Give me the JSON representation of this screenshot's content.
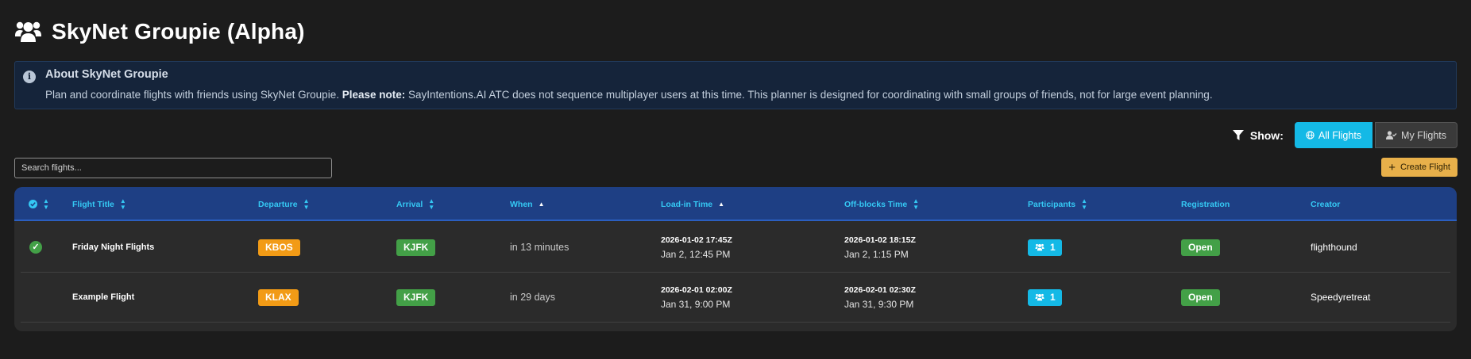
{
  "header": {
    "title": "SkyNet Groupie (Alpha)",
    "icon": "users-icon"
  },
  "about": {
    "heading": "About SkyNet Groupie",
    "text_before": "Plan and coordinate flights with friends using SkyNet Groupie.",
    "note_label": "Please note:",
    "text_after": "SayIntentions.AI ATC does not sequence multiplayer users at this time. This planner is designed for coordinating with small groups of friends, not for large event planning."
  },
  "filter": {
    "label": "Show:",
    "all_label": "All Flights",
    "my_label": "My Flights",
    "active": "All Flights"
  },
  "search": {
    "placeholder": "Search flights..."
  },
  "create_button": {
    "label": "Create Flight"
  },
  "table": {
    "headers": {
      "flight_title": "Flight Title",
      "departure": "Departure",
      "arrival": "Arrival",
      "when": "When",
      "load_in": "Load-in Time",
      "off_blocks": "Off-blocks Time",
      "participants": "Participants",
      "registration": "Registration",
      "creator": "Creator"
    },
    "rows": [
      {
        "joined": true,
        "title": "Friday Night Flights",
        "departure": "KBOS",
        "arrival": "KJFK",
        "when": "in 13 minutes",
        "load_in_utc": "2026-01-02 17:45Z",
        "load_in_local": "Jan 2, 12:45 PM",
        "off_blocks_utc": "2026-01-02 18:15Z",
        "off_blocks_local": "Jan 2, 1:15 PM",
        "participants": "1",
        "registration": "Open",
        "creator": "flighthound"
      },
      {
        "joined": false,
        "title": "Example Flight",
        "departure": "KLAX",
        "arrival": "KJFK",
        "when": "in 29 days",
        "load_in_utc": "2026-02-01 02:00Z",
        "load_in_local": "Jan 31, 9:00 PM",
        "off_blocks_utc": "2026-02-01 02:30Z",
        "off_blocks_local": "Jan 31, 9:30 PM",
        "participants": "1",
        "registration": "Open",
        "creator": "Speedyretreat"
      }
    ]
  },
  "colors": {
    "accent_cyan": "#14b9e6",
    "departure_badge": "#f29b16",
    "arrival_badge": "#43a047",
    "create_button": "#e8b04a",
    "table_header": "#1e3f84"
  }
}
